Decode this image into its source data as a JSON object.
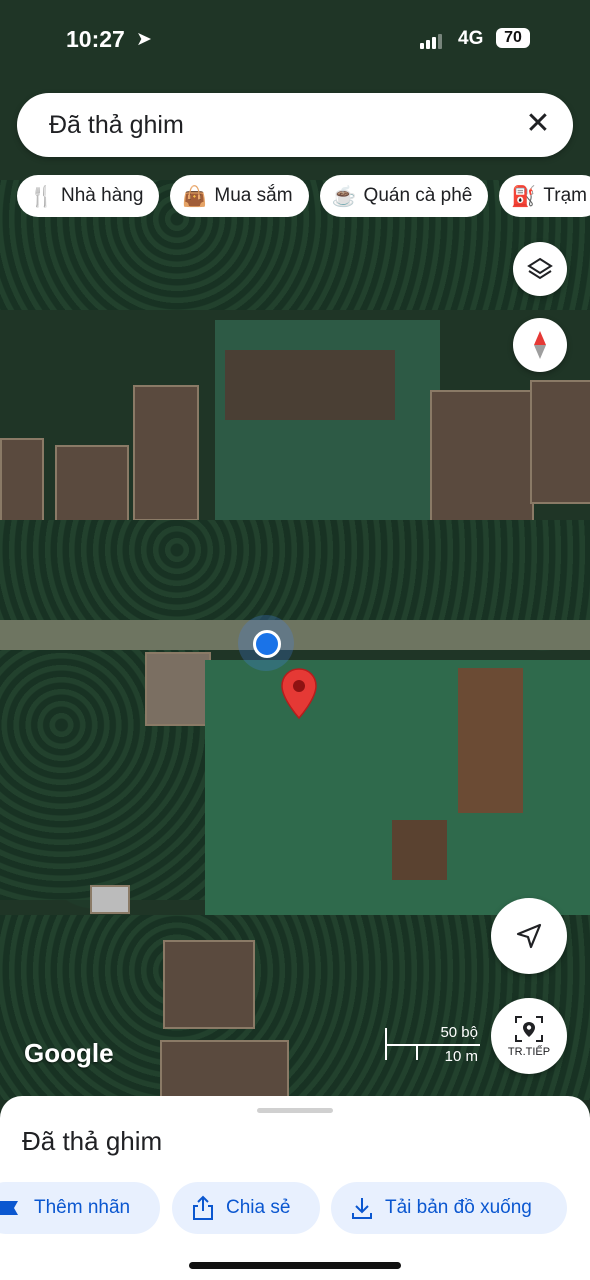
{
  "status_bar": {
    "time": "10:27",
    "network": "4G",
    "battery": "70"
  },
  "search": {
    "text": "Đã thả ghim"
  },
  "chips": [
    {
      "label": "Nhà hàng",
      "icon": "restaurant-icon"
    },
    {
      "label": "Mua sắm",
      "icon": "shopping-bag-icon"
    },
    {
      "label": "Quán cà phê",
      "icon": "coffee-icon"
    },
    {
      "label": "Trạm",
      "icon": "gas-station-icon"
    }
  ],
  "map": {
    "attribution": "Google",
    "scale": {
      "imperial": "50 bộ",
      "metric": "10 m"
    },
    "next_button_label": "TR.TIẾP"
  },
  "sheet": {
    "title": "Đã thả ghim",
    "actions": [
      {
        "label": "Thêm nhãn",
        "icon": "label-flag-icon"
      },
      {
        "label": "Chia sẻ",
        "icon": "share-icon"
      },
      {
        "label": "Tải bản đồ xuống",
        "icon": "download-icon"
      }
    ]
  },
  "colors": {
    "accent": "#0b57d0",
    "chip_bg": "#ffffff",
    "action_bg": "#e8f0fe",
    "pin": "#e53935",
    "location_dot": "#1a73e8"
  }
}
